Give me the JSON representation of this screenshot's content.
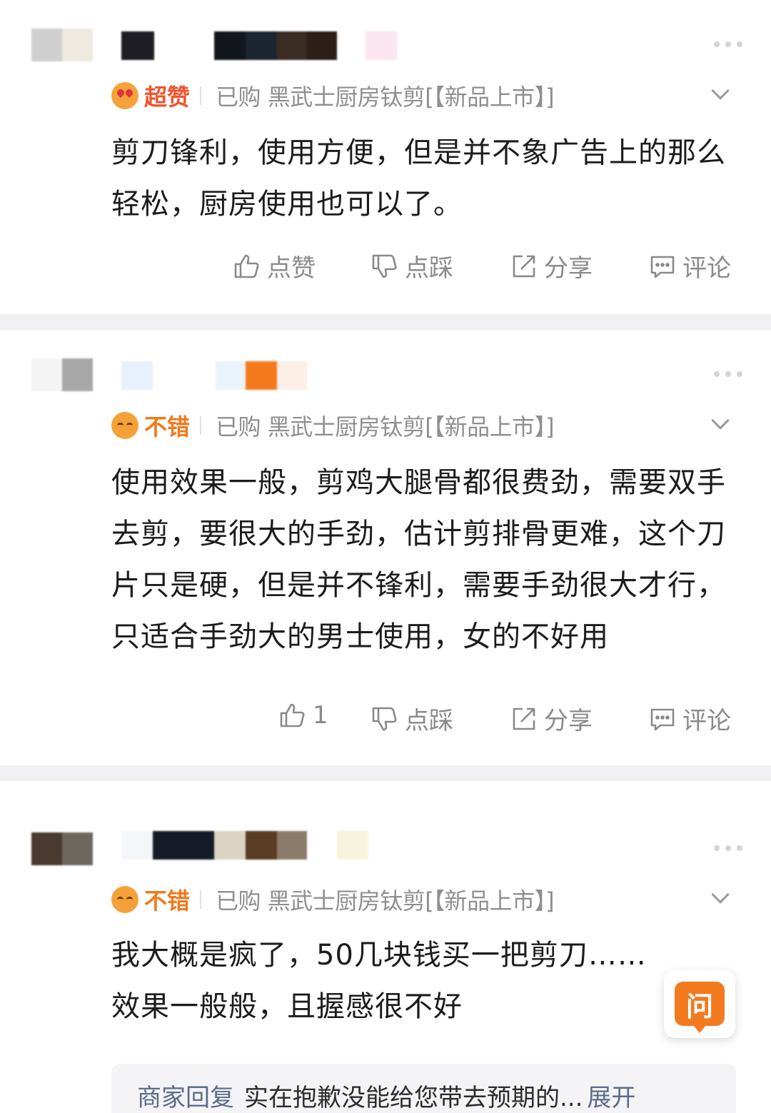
{
  "reviews": [
    {
      "rating_label": "超赞",
      "rating_type": "super",
      "purchase_info": "已购 黑武士厨房钛剪[【新品上市】]",
      "text": "剪刀锋利，使用方便，但是并不象广告上的那么轻松，厨房使用也可以了。",
      "actions": {
        "like": "点赞",
        "dislike": "点踩",
        "share": "分享",
        "comment": "评论"
      }
    },
    {
      "rating_label": "不错",
      "rating_type": "good",
      "purchase_info": "已购 黑武士厨房钛剪[【新品上市】]",
      "text": "使用效果一般，剪鸡大腿骨都很费劲，需要双手去剪，要很大的手劲，估计剪排骨更难，这个刀片只是硬，但是并不锋利，需要手劲很大才行，只适合手劲大的男士使用，女的不好用",
      "actions": {
        "like": "1",
        "dislike": "点踩",
        "share": "分享",
        "comment": "评论"
      }
    },
    {
      "rating_label": "不错",
      "rating_type": "good",
      "purchase_info": "已购 黑武士厨房钛剪[【新品上市】]",
      "text": "我大概是疯了，50几块钱买一把剪刀……效果一般般，且握感很不好",
      "merchant_reply": {
        "label": "商家回复",
        "text": "实在抱歉没能给您带去预期的...",
        "expand": "展开"
      }
    }
  ],
  "ask_button": {
    "label": "问"
  },
  "colors": {
    "super_rating": "#f0542d",
    "good_rating": "#f07a1c",
    "ask_orange": "#f47a1f",
    "muted_text": "#8a8a8a"
  },
  "icons": [
    "thumb-up-icon",
    "thumb-down-icon",
    "share-icon",
    "comment-icon",
    "more-dots-icon",
    "chevron-down-icon",
    "rating-face-icon"
  ]
}
